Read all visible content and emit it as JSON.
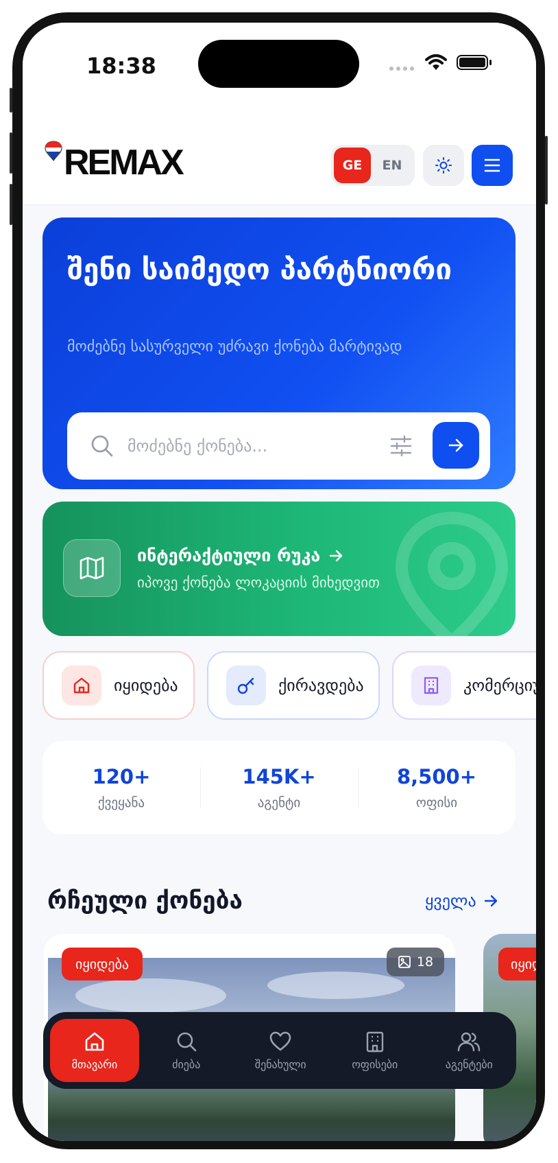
{
  "status_bar": {
    "time": "18:38"
  },
  "header": {
    "logo_text": "REMAX",
    "languages": {
      "active": "GE",
      "other": "EN"
    }
  },
  "hero": {
    "title": "შენი საიმედო პარტნიორი",
    "subtitle": "მოძებნე სასურველი უძრავი ქონება მარტივად",
    "search": {
      "placeholder": "მოძებნე ქონება..."
    }
  },
  "map_card": {
    "title": "ინტერაქტიული რუკა",
    "subtitle": "იპოვე ქონება ლოკაციის მიხედვით"
  },
  "categories": [
    {
      "label": "იყიდება",
      "icon": "home-icon",
      "color": "#e8261c"
    },
    {
      "label": "ქირავდება",
      "icon": "key-icon",
      "color": "#0f45d8"
    },
    {
      "label": "კომერციული",
      "icon": "building-icon",
      "color": "#8b5cf6"
    }
  ],
  "stats": [
    {
      "value": "120+",
      "label": "ქვეყანა"
    },
    {
      "value": "145K+",
      "label": "აგენტი"
    },
    {
      "value": "8,500+",
      "label": "ოფისი"
    }
  ],
  "featured": {
    "title": "რჩეული ქონება",
    "see_all": "ყველა",
    "cards": [
      {
        "badge": "იყიდება",
        "photos": "18"
      },
      {
        "badge": "იყიდება"
      }
    ]
  },
  "tabbar": {
    "items": [
      {
        "label": "მთავარი",
        "icon": "home-icon",
        "active": true
      },
      {
        "label": "ძიება",
        "icon": "search-icon"
      },
      {
        "label": "შენახული",
        "icon": "heart-icon"
      },
      {
        "label": "ოფისები",
        "icon": "building-icon"
      },
      {
        "label": "აგენტები",
        "icon": "users-icon"
      }
    ]
  },
  "colors": {
    "brand_blue": "#0f4ff0",
    "brand_red": "#e8261c",
    "map_green": "#1db777"
  }
}
